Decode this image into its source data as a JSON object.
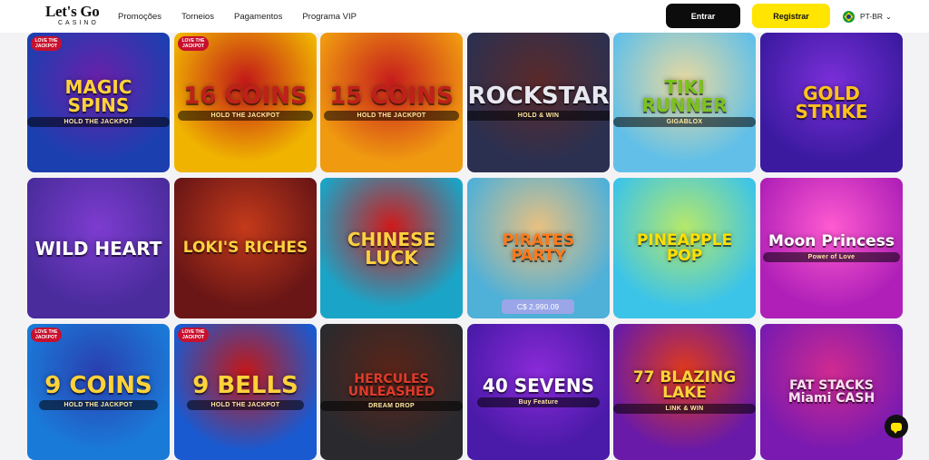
{
  "header": {
    "logo_main": "Let's Go",
    "logo_sub": "CASINO",
    "nav": [
      "Promoções",
      "Torneios",
      "Pagamentos",
      "Programa VIP"
    ],
    "login_label": "Entrar",
    "register_label": "Registrar",
    "language": "PT-BR"
  },
  "games": [
    {
      "title": "MAGIC SPINS",
      "sub": "HOLD THE JACKPOT",
      "badge": "LOVE THE JACKPOT",
      "color": "#1c3fb0",
      "color2": "#6a1fa8",
      "text": "#ffd23a"
    },
    {
      "title": "16 COINS",
      "sub": "HOLD THE JACKPOT",
      "badge": "LOVE THE JACKPOT",
      "color": "#f0b400",
      "color2": "#c21818",
      "text": "#c0201a"
    },
    {
      "title": "15 COINS",
      "sub": "HOLD THE JACKPOT",
      "badge": "",
      "color": "#f09a10",
      "color2": "#c61c1c",
      "text": "#c0201a"
    },
    {
      "title": "ROCKSTAR",
      "sub": "HOLD & WIN",
      "badge": "",
      "color": "#2c3050",
      "color2": "#5a2a2a",
      "text": "#e8e8f0"
    },
    {
      "title": "TIKI RUNNER",
      "sub": "GIGABLOX",
      "badge": "",
      "color": "#62c0e8",
      "color2": "#e8d9a0",
      "text": "#7cc21e"
    },
    {
      "title": "GOLD STRIKE",
      "sub": "",
      "badge": "",
      "color": "#3b1aa0",
      "color2": "#7a2fd8",
      "text": "#ffc21a"
    },
    {
      "title": "WILD HEART",
      "sub": "",
      "badge": "",
      "color": "#4a2c9c",
      "color2": "#7d3cd0",
      "text": "#ffffff"
    },
    {
      "title": "LOKI'S RICHES",
      "sub": "",
      "badge": "",
      "color": "#6a1616",
      "color2": "#c43a1a",
      "text": "#ffd040"
    },
    {
      "title": "CHINESE LUCK",
      "sub": "",
      "badge": "",
      "color": "#1aa5c8",
      "color2": "#d01a1a",
      "text": "#ffd040"
    },
    {
      "title": "PIRATES PARTY",
      "sub": "",
      "badge": "",
      "color": "#4fb0d8",
      "color2": "#e8c080",
      "text": "#ff7a1a",
      "price": "C$ 2,990.09"
    },
    {
      "title": "PINEAPPLE POP",
      "sub": "",
      "badge": "",
      "color": "#3cc4e8",
      "color2": "#b6e86a",
      "text": "#ffe000"
    },
    {
      "title": "Moon Princess",
      "sub": "Power of Love",
      "badge": "",
      "color": "#b020b8",
      "color2": "#ff5ad0",
      "text": "#ffffff"
    },
    {
      "title": "9 COINS",
      "sub": "HOLD THE JACKPOT",
      "badge": "LOVE THE JACKPOT",
      "color": "#1a7ad8",
      "color2": "#2a3fb0",
      "text": "#ffd23a"
    },
    {
      "title": "9 BELLS",
      "sub": "HOLD THE JACKPOT",
      "badge": "LOVE THE JACKPOT",
      "color": "#1a5ad0",
      "color2": "#c21818",
      "text": "#ffd23a"
    },
    {
      "title": "HERCULES UNLEASHED",
      "sub": "DREAM DROP",
      "badge": "",
      "color": "#2a2a2e",
      "color2": "#5a2418",
      "text": "#e03a2a"
    },
    {
      "title": "40 SEVENS",
      "sub": "Buy Feature",
      "badge": "",
      "color": "#4a1aa8",
      "color2": "#8a2ad8",
      "text": "#ffffff"
    },
    {
      "title": "77 BLAZING LAKE",
      "sub": "LINK & WIN",
      "badge": "",
      "color": "#6a1aa8",
      "color2": "#e03a1a",
      "text": "#ffd23a"
    },
    {
      "title": "FAT STACKS Miami CASH",
      "sub": "",
      "badge": "",
      "color": "#7a1ab0",
      "color2": "#d02a90",
      "text": "#ffe0f0"
    }
  ]
}
